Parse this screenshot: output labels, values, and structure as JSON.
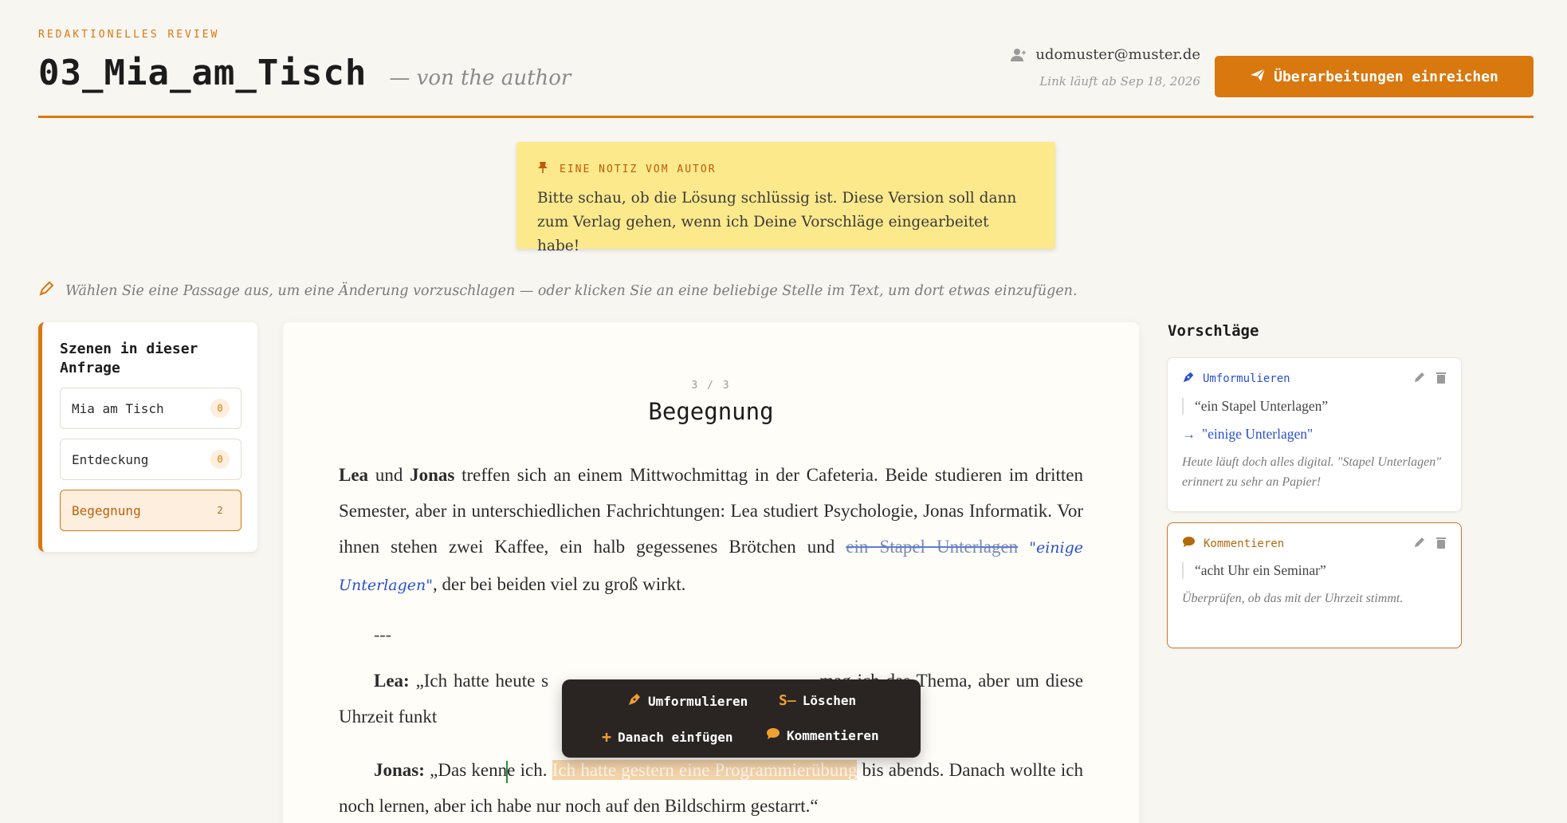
{
  "header": {
    "eyebrow": "Redaktionelles Review",
    "title": "03_Mia_am_Tisch",
    "byline": "— von the author",
    "user_email": "udomuster@muster.de",
    "link_expiry": "Link läuft ab Sep 18, 2026",
    "submit_label": "Überarbeitungen einreichen",
    "accent_color": "#d9780f"
  },
  "note": {
    "label": "Eine Notiz vom Autor",
    "text": "Bitte schau, ob die Lösung schlüssig ist. Diese Version soll dann zum Verlag gehen, wenn ich Deine Vorschläge eingearbeitet habe!",
    "background": "#fbe98c"
  },
  "hint": "Wählen Sie eine Passage aus, um eine Änderung vorzuschlagen — oder klicken Sie an eine beliebige Stelle im Text, um dort etwas einzufügen.",
  "scenes": {
    "title": "Szenen in dieser Anfrage",
    "items": [
      {
        "label": "Mia am Tisch",
        "count": "0"
      },
      {
        "label": "Entdeckung",
        "count": "0"
      },
      {
        "label": "Begegnung",
        "count": "2"
      }
    ]
  },
  "editor": {
    "page": "3 / 3",
    "scene_title": "Begegnung",
    "p1": {
      "name1": "Lea",
      "und": " und ",
      "name2": "Jonas",
      "text_a": " treffen sich an einem Mittwochmittag in der Cafeteria. Beide studieren im dritten Semester, aber in unterschiedlichen Fachrichtungen: Lea studiert Psychologie, Jonas Informatik. Vor ihnen stehen zwei Kaffee, ein halb gegessenes Brötchen und ",
      "struck": "ein Stapel Unterlagen",
      "inserted": "\"einige Unterlagen\"",
      "text_b": ", der bei beiden viel zu groß wirkt."
    },
    "separator": "---",
    "p2": {
      "speaker": "Lea:",
      "text": " „Ich hatte heute s",
      "text_right": "mag ich das Thema, aber um diese Uhrzeit funkt"
    },
    "p3": {
      "speaker": "Jonas:",
      "text_a": " „Das kenn",
      "text_b": "e ich. ",
      "highlight": "Ich hatte gestern eine Programmierübung",
      "text_c": " bis abends. Danach wollte ich noch lernen, aber ich habe nur noch auf den Bildschirm gestarrt.“"
    }
  },
  "popover": {
    "rephrase": "Umformulieren",
    "delete": "Löschen",
    "insert_after": "Danach einfügen",
    "comment": "Kommentieren"
  },
  "suggestions": {
    "title": "Vorschläge",
    "items": [
      {
        "type": "Umformulieren",
        "type_color": "#2a4fd0",
        "quote": "“ein Stapel Unterlagen”",
        "replacement": "\"einige Unterlagen\"",
        "note": "Heute läuft doch alles digital. \"Stapel Unterlagen\" erinnert zu sehr an Papier!"
      },
      {
        "type": "Kommentieren",
        "type_color": "#b36a0a",
        "quote": "“acht Uhr ein Seminar”",
        "note": "Überprüfen, ob das mit der Uhrzeit stimmt."
      }
    ]
  }
}
